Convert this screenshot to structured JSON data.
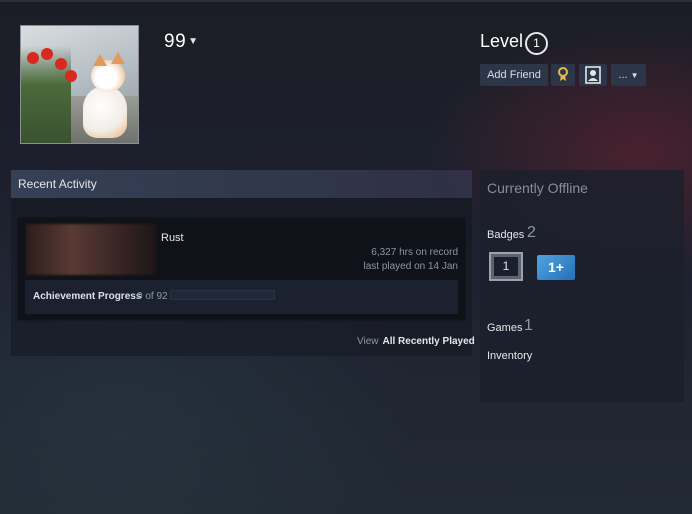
{
  "profile": {
    "persona_name": "99",
    "level_label": "Level",
    "level_value": "1"
  },
  "actions": {
    "add_friend": "Add Friend",
    "more": "..."
  },
  "recent_activity": {
    "header": "Recent Activity",
    "game": {
      "title": "Rust",
      "hours_on_record": "6,327 hrs on record",
      "last_played": "last played on 14 Jan",
      "achievement_label": "Achievement Progress",
      "achievement_count": "0 of 92",
      "achievement_fraction": 0
    },
    "view_label": "View",
    "view_link": "All Recently Played"
  },
  "side_panel": {
    "status": "Currently Offline",
    "badges_label": "Badges",
    "badges_count": "2",
    "badge_items": [
      "1",
      "1+"
    ],
    "games_label": "Games",
    "games_count": "1",
    "inventory_label": "Inventory"
  },
  "colors": {
    "achievement_bar": "#22283a",
    "badge_blue": "#2670b8"
  }
}
